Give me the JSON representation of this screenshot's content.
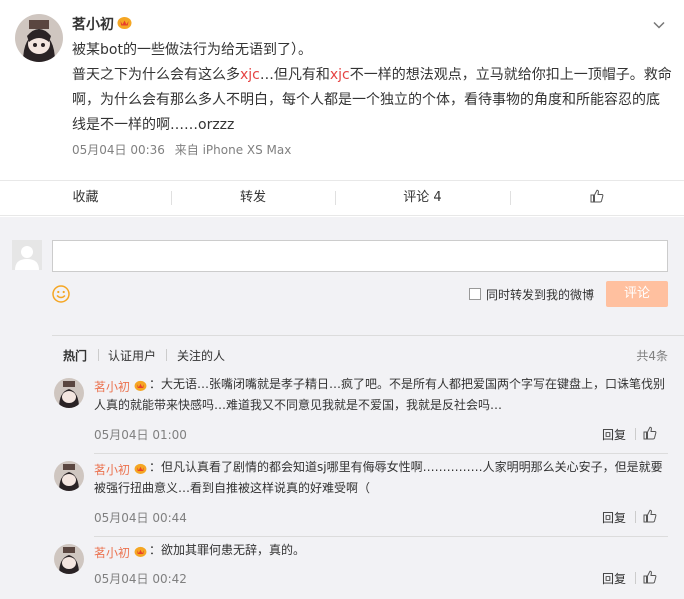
{
  "post": {
    "author": "茗小初",
    "line1": "被某bot的一些做法行为给无语到了）。",
    "line2": {
      "a": "普天之下为什么会有这么多",
      "h1": "xjc",
      "b": "…但凡有和",
      "h2": "xjc",
      "c": "不一样的想法观点，立马就给你扣上一顶帽子。救命"
    },
    "line3": "啊，为什么会有那么多人不明白，每个人都是一个独立的个体，看待事物的角度和所能容忍的底",
    "line4": "线是不一样的啊……orzzz",
    "time": "05月04日 00:36",
    "source": "来自 iPhone XS Max"
  },
  "actions": {
    "favorite": "收藏",
    "repost": "转发",
    "comment": "评论 4"
  },
  "composer": {
    "repost_label": "同时转发到我的微博",
    "submit_label": "评论"
  },
  "filters": {
    "hot": "热门",
    "verified": "认证用户",
    "following": "关注的人",
    "count": "共4条"
  },
  "comments": [
    {
      "name": "茗小初",
      "line1": "：大无语…张嘴闭嘴就是孝子精日…疯了吧。不是所有人都把爱国两个字写在键盘上，口诛笔伐别",
      "line2": "人真的就能带来快感吗…难道我又不同意见我就是不爱国，我就是反社会吗…",
      "date": "05月04日 01:00",
      "reply": "回复"
    },
    {
      "name": "茗小初",
      "line1": "：但凡认真看了剧情的都会知道sj哪里有侮辱女性啊……………人家明明那么关心安子，但是就要",
      "line2": "被强行扭曲意义…看到自推被这样说真的好难受啊（",
      "date": "05月04日 00:44",
      "reply": "回复"
    },
    {
      "name": "茗小初",
      "line1": "：欲加其罪何患无辞，真的。",
      "date": "05月04日 00:42",
      "reply": "回复"
    }
  ]
}
